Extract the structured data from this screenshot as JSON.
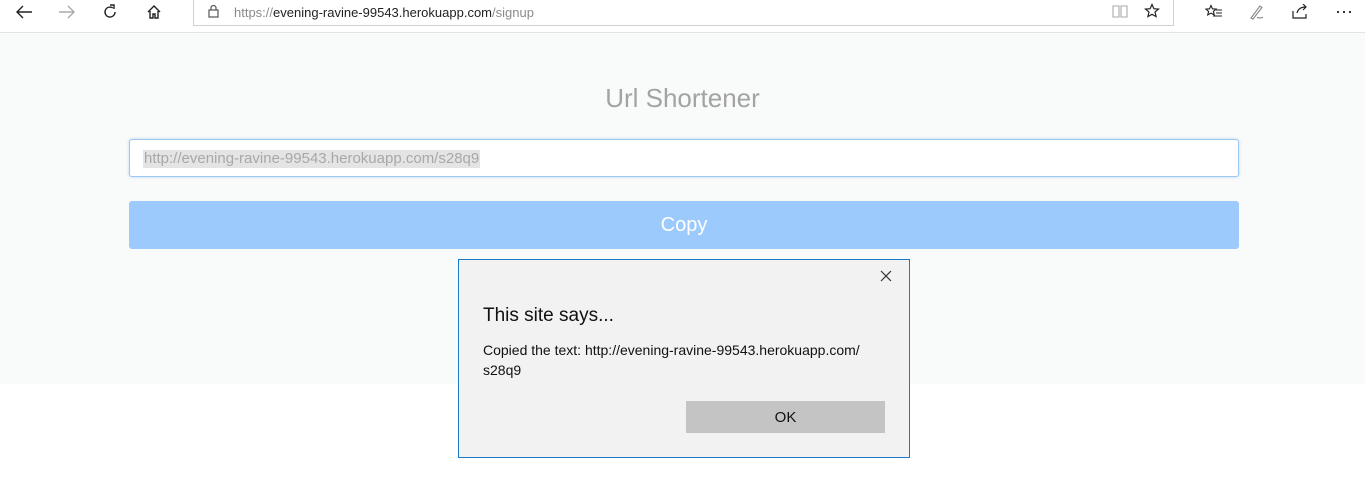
{
  "browser": {
    "address": {
      "scheme": "https://",
      "host": "evening-ravine-99543.herokuapp.com",
      "path": "/signup"
    }
  },
  "app": {
    "title": "Url Shortener",
    "input_value": "http://evening-ravine-99543.herokuapp.com/s28q9",
    "copy_label": "Copy"
  },
  "dialog": {
    "heading": "This site says...",
    "message_line1": "Copied the text: http://evening-ravine-99543.herokuapp.com/",
    "message_line2": "s28q9",
    "ok_label": "OK"
  }
}
